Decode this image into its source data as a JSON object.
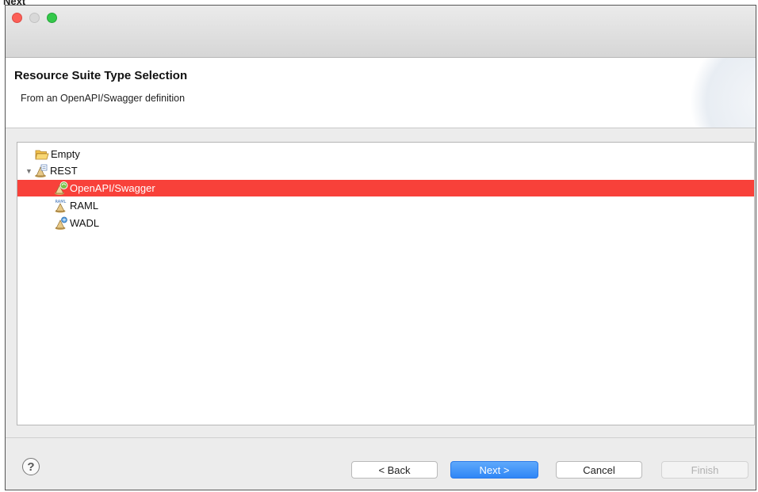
{
  "page": {
    "caption": "Next"
  },
  "header": {
    "title": "Resource Suite Type Selection",
    "description": "From an OpenAPI/Swagger definition"
  },
  "tree": {
    "items": [
      {
        "label": "Empty",
        "icon": "folder-open-icon"
      },
      {
        "label": "REST",
        "icon": "rest-service-icon",
        "expanded": true
      },
      {
        "label": "OpenAPI/Swagger",
        "icon": "swagger-icon",
        "selected": true
      },
      {
        "label": "RAML",
        "icon": "raml-icon"
      },
      {
        "label": "WADL",
        "icon": "wadl-icon"
      }
    ]
  },
  "buttons": {
    "back": "< Back",
    "next": "Next >",
    "cancel": "Cancel",
    "finish": "Finish",
    "help": "?"
  },
  "colors": {
    "selection": "#f8413a",
    "primary_button": "#2f86f6",
    "close": "#fc5f57",
    "zoom": "#34c84a"
  }
}
